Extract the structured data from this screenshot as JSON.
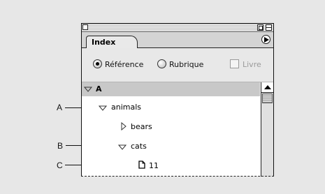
{
  "panel": {
    "tab_label": "Index"
  },
  "options": {
    "reference_label": "Référence",
    "topic_label": "Rubrique",
    "book_label": "Livre",
    "selected": "Référence"
  },
  "list": {
    "section": "A",
    "items": [
      {
        "label": "animals",
        "expander": "expanded"
      },
      {
        "label": "bears",
        "expander": "collapsed"
      },
      {
        "label": "cats",
        "expander": "expanded"
      },
      {
        "label": "11",
        "expander": "page-reference"
      }
    ]
  },
  "callouts": [
    "A",
    "B",
    "C"
  ],
  "icons": [
    "close-box-icon",
    "zoom-box-icon",
    "collapse-box-icon",
    "panel-menu-icon",
    "disclosure-triangle-icon",
    "page-icon",
    "scroll-up-arrow-icon"
  ]
}
